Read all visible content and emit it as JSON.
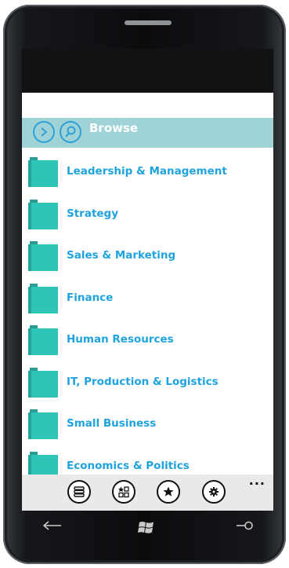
{
  "header": {
    "title": "Browse"
  },
  "categories": [
    "Leadership & Management",
    "Strategy",
    "Sales & Marketing",
    "Finance",
    "Human Resources",
    "IT, Production & Logistics",
    "Small Business",
    "Economics & Politics"
  ],
  "appbar": {
    "more_label": "..."
  },
  "colors": {
    "accent": "#1fa3de",
    "header_bg": "#9fd3d8",
    "folder": "#2ec4b7"
  }
}
